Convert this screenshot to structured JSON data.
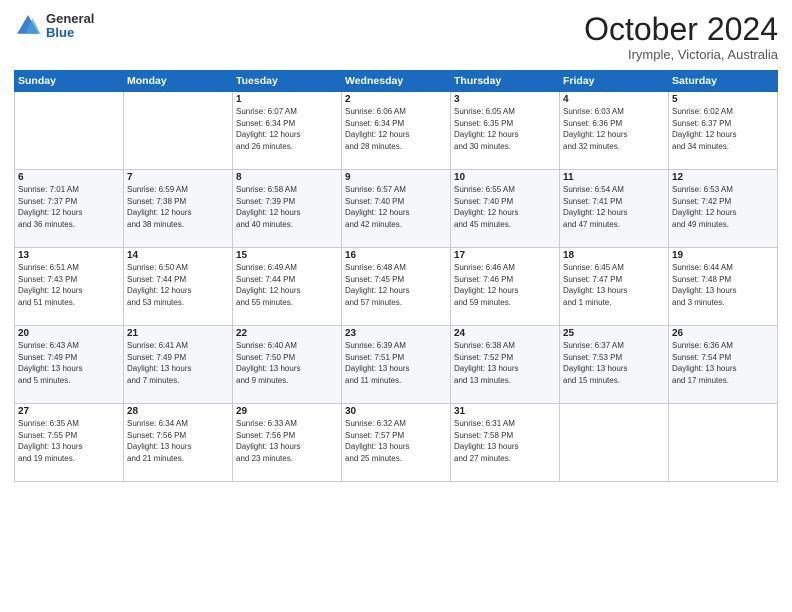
{
  "logo": {
    "general": "General",
    "blue": "Blue"
  },
  "title": "October 2024",
  "location": "Irymple, Victoria, Australia",
  "weekdays": [
    "Sunday",
    "Monday",
    "Tuesday",
    "Wednesday",
    "Thursday",
    "Friday",
    "Saturday"
  ],
  "weeks": [
    [
      {
        "day": "",
        "info": ""
      },
      {
        "day": "",
        "info": ""
      },
      {
        "day": "1",
        "info": "Sunrise: 6:07 AM\nSunset: 6:34 PM\nDaylight: 12 hours\nand 26 minutes."
      },
      {
        "day": "2",
        "info": "Sunrise: 6:06 AM\nSunset: 6:34 PM\nDaylight: 12 hours\nand 28 minutes."
      },
      {
        "day": "3",
        "info": "Sunrise: 6:05 AM\nSunset: 6:35 PM\nDaylight: 12 hours\nand 30 minutes."
      },
      {
        "day": "4",
        "info": "Sunrise: 6:03 AM\nSunset: 6:36 PM\nDaylight: 12 hours\nand 32 minutes."
      },
      {
        "day": "5",
        "info": "Sunrise: 6:02 AM\nSunset: 6:37 PM\nDaylight: 12 hours\nand 34 minutes."
      }
    ],
    [
      {
        "day": "6",
        "info": "Sunrise: 7:01 AM\nSunset: 7:37 PM\nDaylight: 12 hours\nand 36 minutes."
      },
      {
        "day": "7",
        "info": "Sunrise: 6:59 AM\nSunset: 7:38 PM\nDaylight: 12 hours\nand 38 minutes."
      },
      {
        "day": "8",
        "info": "Sunrise: 6:58 AM\nSunset: 7:39 PM\nDaylight: 12 hours\nand 40 minutes."
      },
      {
        "day": "9",
        "info": "Sunrise: 6:57 AM\nSunset: 7:40 PM\nDaylight: 12 hours\nand 42 minutes."
      },
      {
        "day": "10",
        "info": "Sunrise: 6:55 AM\nSunset: 7:40 PM\nDaylight: 12 hours\nand 45 minutes."
      },
      {
        "day": "11",
        "info": "Sunrise: 6:54 AM\nSunset: 7:41 PM\nDaylight: 12 hours\nand 47 minutes."
      },
      {
        "day": "12",
        "info": "Sunrise: 6:53 AM\nSunset: 7:42 PM\nDaylight: 12 hours\nand 49 minutes."
      }
    ],
    [
      {
        "day": "13",
        "info": "Sunrise: 6:51 AM\nSunset: 7:43 PM\nDaylight: 12 hours\nand 51 minutes."
      },
      {
        "day": "14",
        "info": "Sunrise: 6:50 AM\nSunset: 7:44 PM\nDaylight: 12 hours\nand 53 minutes."
      },
      {
        "day": "15",
        "info": "Sunrise: 6:49 AM\nSunset: 7:44 PM\nDaylight: 12 hours\nand 55 minutes."
      },
      {
        "day": "16",
        "info": "Sunrise: 6:48 AM\nSunset: 7:45 PM\nDaylight: 12 hours\nand 57 minutes."
      },
      {
        "day": "17",
        "info": "Sunrise: 6:46 AM\nSunset: 7:46 PM\nDaylight: 12 hours\nand 59 minutes."
      },
      {
        "day": "18",
        "info": "Sunrise: 6:45 AM\nSunset: 7:47 PM\nDaylight: 13 hours\nand 1 minute."
      },
      {
        "day": "19",
        "info": "Sunrise: 6:44 AM\nSunset: 7:48 PM\nDaylight: 13 hours\nand 3 minutes."
      }
    ],
    [
      {
        "day": "20",
        "info": "Sunrise: 6:43 AM\nSunset: 7:49 PM\nDaylight: 13 hours\nand 5 minutes."
      },
      {
        "day": "21",
        "info": "Sunrise: 6:41 AM\nSunset: 7:49 PM\nDaylight: 13 hours\nand 7 minutes."
      },
      {
        "day": "22",
        "info": "Sunrise: 6:40 AM\nSunset: 7:50 PM\nDaylight: 13 hours\nand 9 minutes."
      },
      {
        "day": "23",
        "info": "Sunrise: 6:39 AM\nSunset: 7:51 PM\nDaylight: 13 hours\nand 11 minutes."
      },
      {
        "day": "24",
        "info": "Sunrise: 6:38 AM\nSunset: 7:52 PM\nDaylight: 13 hours\nand 13 minutes."
      },
      {
        "day": "25",
        "info": "Sunrise: 6:37 AM\nSunset: 7:53 PM\nDaylight: 13 hours\nand 15 minutes."
      },
      {
        "day": "26",
        "info": "Sunrise: 6:36 AM\nSunset: 7:54 PM\nDaylight: 13 hours\nand 17 minutes."
      }
    ],
    [
      {
        "day": "27",
        "info": "Sunrise: 6:35 AM\nSunset: 7:55 PM\nDaylight: 13 hours\nand 19 minutes."
      },
      {
        "day": "28",
        "info": "Sunrise: 6:34 AM\nSunset: 7:56 PM\nDaylight: 13 hours\nand 21 minutes."
      },
      {
        "day": "29",
        "info": "Sunrise: 6:33 AM\nSunset: 7:56 PM\nDaylight: 13 hours\nand 23 minutes."
      },
      {
        "day": "30",
        "info": "Sunrise: 6:32 AM\nSunset: 7:57 PM\nDaylight: 13 hours\nand 25 minutes."
      },
      {
        "day": "31",
        "info": "Sunrise: 6:31 AM\nSunset: 7:58 PM\nDaylight: 13 hours\nand 27 minutes."
      },
      {
        "day": "",
        "info": ""
      },
      {
        "day": "",
        "info": ""
      }
    ]
  ]
}
